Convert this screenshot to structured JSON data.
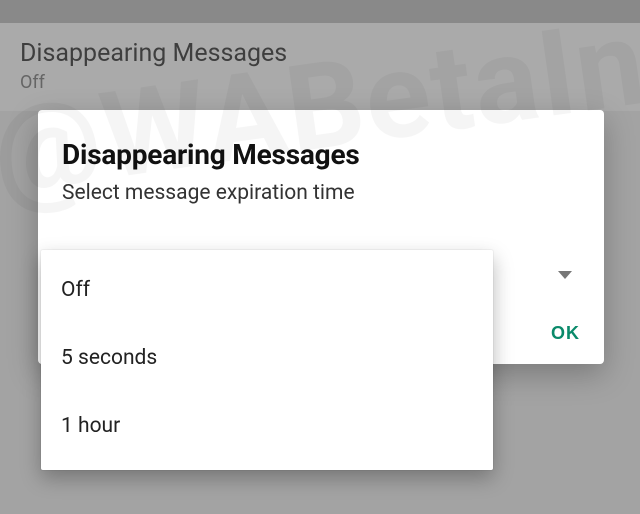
{
  "setting": {
    "title": "Disappearing Messages",
    "current": "Off"
  },
  "dialog": {
    "title": "Disappearing Messages",
    "subtitle": "Select message expiration time",
    "ok_label": "OK"
  },
  "options": [
    {
      "label": "Off"
    },
    {
      "label": "5 seconds"
    },
    {
      "label": "1 hour"
    }
  ],
  "watermark": "@WABetaInfo"
}
